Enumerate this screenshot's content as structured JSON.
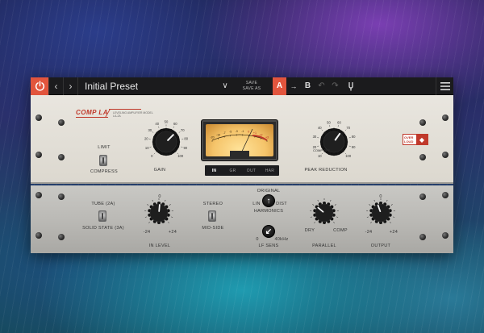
{
  "toolbar": {
    "power_icon": "power-icon",
    "prev_glyph": "‹",
    "next_glyph": "›",
    "preset_name": "Initial Preset",
    "dropdown_glyph": "∨",
    "save_label": "SAVE",
    "save_as_label": "SAVE AS",
    "a_label": "A",
    "b_label": "B",
    "copy_glyph": "→",
    "undo_glyph": "↶",
    "redo_glyph": "↷",
    "tool_icon": "tuning-fork-icon",
    "menu_icon": "hamburger-menu-icon",
    "accent_color": "#e2553d"
  },
  "top_panel": {
    "brand": "COMP LA",
    "brand_sub": "LEVELING AMPLIFIER MODEL LA-2A",
    "limit_label": "LIMIT",
    "compress_label": "COMPRESS",
    "gain": {
      "label": "GAIN",
      "scale": [
        "0",
        "10",
        "20",
        "30",
        "40",
        "50",
        "60",
        "70",
        "80",
        "90",
        "100"
      ]
    },
    "meter": {
      "scale": [
        "-20",
        "-10",
        "-7",
        "-5",
        "-3",
        "-1",
        "0",
        "+1",
        "+2",
        "+3"
      ]
    },
    "meter_modes": [
      "IN",
      "GR",
      "OUT",
      "HAR"
    ],
    "meter_mode_active": "IN",
    "peak_reduction": {
      "label": "PEAK REDUCTION",
      "off_label": "COMP OFF",
      "scale": [
        "10",
        "20",
        "30",
        "40",
        "50",
        "60",
        "70",
        "80",
        "90",
        "100"
      ]
    },
    "overload_text": "OVER LOUD",
    "overload_icon": "diamond-icon",
    "brand_color": "#c0392b"
  },
  "bottom_panel": {
    "tube_label": "TUBE (2A)",
    "solid_state_label": "SOLID STATE (3A)",
    "in_level": {
      "label": "IN LEVEL",
      "top": "0",
      "min": "-24",
      "max": "+24"
    },
    "stereo_label": "STEREO",
    "mid_side_label": "MID-SIDE",
    "harmonics": {
      "label": "HARMONICS",
      "original": "ORIGINAL",
      "lin": "LIN",
      "dist": "DIST"
    },
    "lf_sens": {
      "label": "LF SENS",
      "min": "0",
      "max": "40kHz"
    },
    "parallel": {
      "label": "PARALLEL",
      "dry": "DRY",
      "comp": "COMP"
    },
    "output": {
      "label": "OUTPUT",
      "top": "0",
      "min": "-24",
      "max": "+24"
    }
  }
}
